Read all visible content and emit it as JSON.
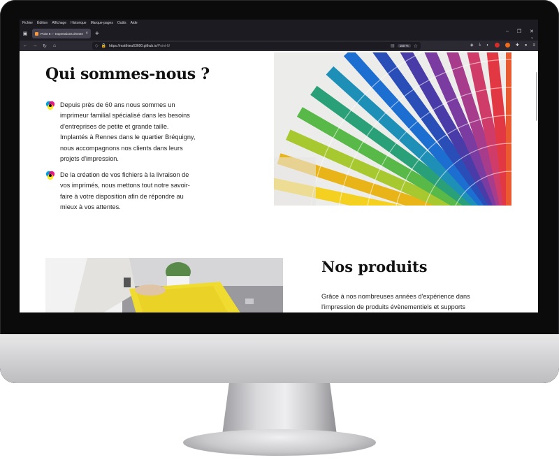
{
  "browser": {
    "menu": [
      "Fichier",
      "Édition",
      "Affichage",
      "Historique",
      "Marque-pages",
      "Outils",
      "Aide"
    ],
    "tab_title": "Point It ! - Impressions d'entreprise",
    "url_host": "https://matthieu63600.github.io",
    "url_path": "/Point-It/",
    "zoom": "150 %"
  },
  "about": {
    "title": "Qui sommes-nous ?",
    "paragraphs": [
      "Depuis près de 60 ans nous sommes un imprimeur familial spécialisé dans les besoins d'entreprises de petite et grande taille. Implantés à Rennes dans le quartier Bréquigny, nous accompagnons nos clients dans leurs projets d'impression.",
      "De la création de vos fichiers à la livraison de vos imprimés, nous mettons tout notre savoir-faire à votre disposition afin de répondre au mieux à vos attentes."
    ]
  },
  "products": {
    "title": "Nos produits",
    "intro": "Grâce à nos nombreuses années d'expérience dans l'impression de produits évènementiels et supports"
  },
  "icons": {
    "bullet": "cmyk-dots-icon"
  },
  "colors": {
    "cyan": "#00a0e0",
    "magenta": "#e6007e",
    "yellow": "#ffe600",
    "black": "#111111",
    "browser_dark": "#1c1b22"
  }
}
